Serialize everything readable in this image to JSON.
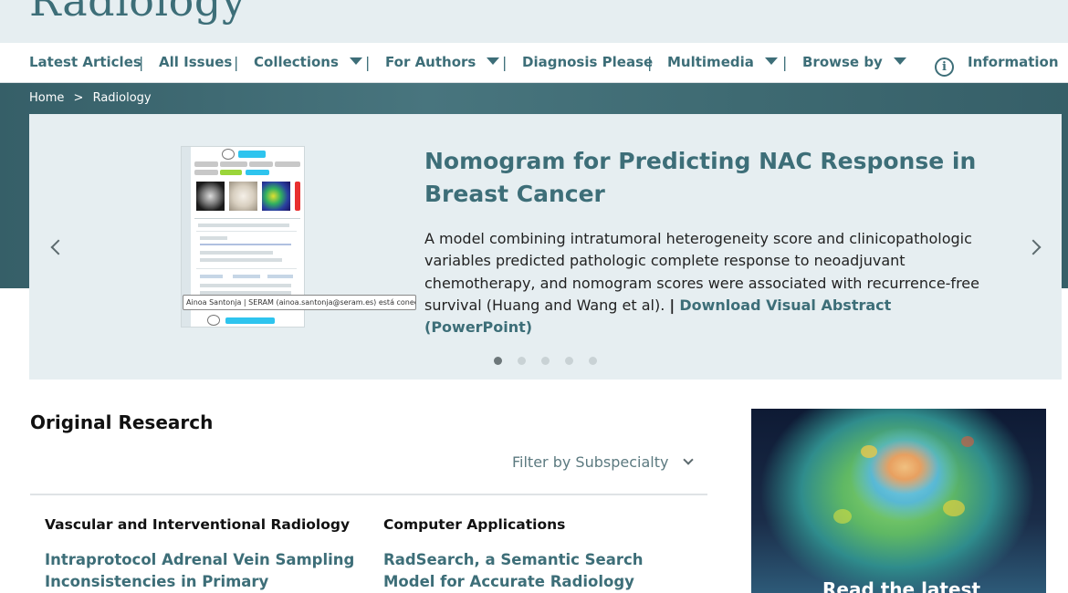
{
  "brand": {
    "logo_text": "Radiology"
  },
  "nav": {
    "items": [
      {
        "label": "Latest Articles",
        "dropdown": false
      },
      {
        "label": "All Issues",
        "dropdown": false
      },
      {
        "label": "Collections",
        "dropdown": true
      },
      {
        "label": "For Authors",
        "dropdown": true
      },
      {
        "label": "Diagnosis Please",
        "dropdown": false
      },
      {
        "label": "Multimedia",
        "dropdown": true
      },
      {
        "label": "Browse by",
        "dropdown": true
      }
    ],
    "separator": "|",
    "information_label": "Information",
    "information_icon": "info-circle-icon"
  },
  "breadcrumb": {
    "home": "Home",
    "separator": ">",
    "current": "Radiology"
  },
  "carousel": {
    "title": "Nomogram for Predicting NAC Response in Breast Cancer",
    "description": "A model combining intratumoral heterogeneity score and clinicopathologic variables predicted pathologic complete response to neoadjuvant chemotherapy, and nomogram scores were associated with recurrence-free survival (Huang and Wang et al).",
    "pipe": "|",
    "download_link": "Download Visual Abstract (PowerPoint)",
    "tooltip": "Ainoa Santonja | SERAM (ainoa.santonja@seram.es) está conectado",
    "slide_count": 5,
    "active_slide": 1,
    "prev_icon": "chevron-left-icon",
    "next_icon": "chevron-right-icon"
  },
  "original_research": {
    "heading": "Original Research",
    "filter_label": "Filter by Subspecialty",
    "columns": [
      {
        "subspecialty": "Vascular and Interventional Radiology",
        "article_title": "Intraprotocol Adrenal Vein Sampling Inconsistencies in Primary"
      },
      {
        "subspecialty": "Computer Applications",
        "article_title": "RadSearch, a Semantic Search Model for Accurate Radiology Report"
      }
    ]
  },
  "promo": {
    "text": "Read the latest"
  },
  "colors": {
    "accent": "#3d6e78",
    "hero_bg": "#48757e",
    "card_bg": "#e6eef1"
  }
}
